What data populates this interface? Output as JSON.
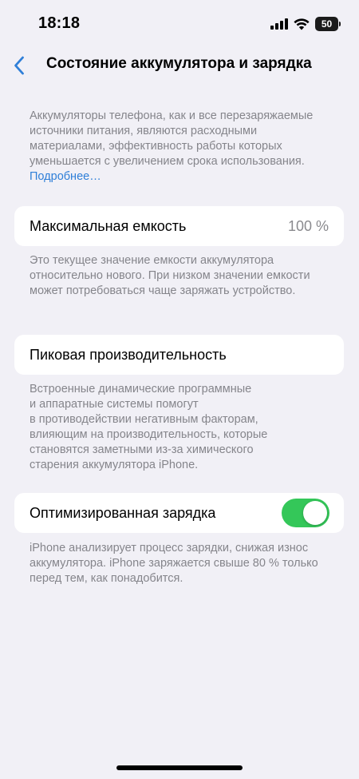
{
  "status_bar": {
    "time": "18:18",
    "battery_level": "50",
    "icons": [
      "cellular-signal-icon",
      "wifi-icon",
      "battery-icon"
    ]
  },
  "nav": {
    "back_icon": "chevron-left-icon",
    "title": "Состояние аккумулятора и зарядка"
  },
  "intro": {
    "text": "Аккумуляторы телефона, как и все перезаряжаемые источники питания, являются расходными материалами, эффективность работы которых уменьшается с увеличением срока использования.",
    "link": "Подробнее…"
  },
  "max_capacity": {
    "label": "Максимальная емкость",
    "value": "100 %",
    "footnote": "Это текущее значение емкости аккумулятора относительно нового. При низком значении емкости может потребоваться чаще заряжать устройство."
  },
  "peak_performance": {
    "label": "Пиковая производительность",
    "footnote_lines": [
      "Встроенные динамические программные",
      "и аппаратные системы помогут",
      "в противодействии негативным факторам,",
      "влияющим на производительность, которые",
      "становятся заметными из-за химического",
      "старения аккумулятора iPhone."
    ]
  },
  "optimized_charging": {
    "label": "Оптимизированная зарядка",
    "enabled": true,
    "footnote": "iPhone анализирует процесс зарядки, снижая износ аккумулятора. iPhone заряжается свыше 80 % только перед тем, как понадобится."
  },
  "colors": {
    "background": "#f1f0f6",
    "accent_link": "#2f7fd8",
    "toggle_on": "#34c759",
    "secondary_text": "#85858b"
  }
}
